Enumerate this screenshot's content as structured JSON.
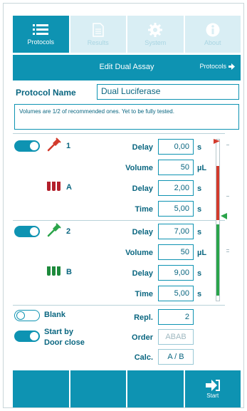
{
  "tabs": [
    {
      "label": "Protocols",
      "icon": "list-icon",
      "active": true
    },
    {
      "label": "Results",
      "icon": "document-icon",
      "active": false
    },
    {
      "label": "System",
      "icon": "gear-icon",
      "active": false
    },
    {
      "label": "About",
      "icon": "info-icon",
      "active": false
    }
  ],
  "header": {
    "title": "Edit Dual Assay",
    "breadcrumb": "Protocols"
  },
  "protocol": {
    "name_label": "Protocol Name",
    "name_value": "Dual Luciferase",
    "note": "Volumes are 1/2 of recommended ones. Yet to be fully tested."
  },
  "injector1": {
    "number": "1",
    "tube_label": "A",
    "enabled": true,
    "fields": [
      {
        "label": "Delay",
        "value": "0,00",
        "unit": "s"
      },
      {
        "label": "Volume",
        "value": "50",
        "unit": "µL"
      },
      {
        "label": "Delay",
        "value": "2,00",
        "unit": "s"
      },
      {
        "label": "Time",
        "value": "5,00",
        "unit": "s"
      }
    ]
  },
  "injector2": {
    "number": "2",
    "tube_label": "B",
    "enabled": true,
    "fields": [
      {
        "label": "Delay",
        "value": "7,00",
        "unit": "s"
      },
      {
        "label": "Volume",
        "value": "50",
        "unit": "µL"
      },
      {
        "label": "Delay",
        "value": "9,00",
        "unit": "s"
      },
      {
        "label": "Time",
        "value": "5,00",
        "unit": "s"
      }
    ]
  },
  "options": {
    "blank_label": "Blank",
    "blank_enabled": false,
    "door_label_1": "Start by",
    "door_label_2": "Door close",
    "door_enabled": true,
    "repl_label": "Repl.",
    "repl_value": "2",
    "order_label": "Order",
    "order_value": "ABAB",
    "calc_label": "Calc.",
    "calc_value": "A / B"
  },
  "bottom": {
    "start_label": "Start"
  },
  "colors": {
    "teal": "#0e93b2",
    "red": "#d33b2c",
    "green": "#2aa44a",
    "tube_red": "#b3202c",
    "tube_green": "#1e8a3c"
  }
}
